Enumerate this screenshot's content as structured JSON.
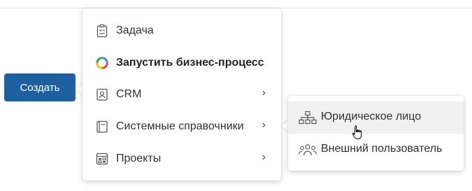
{
  "create_button": {
    "label": "Создать"
  },
  "main_menu": {
    "items": [
      {
        "label": "Задача",
        "icon": "task-clipboard-icon",
        "has_submenu": false
      },
      {
        "label": "Запустить бизнес-процесс",
        "icon": "business-process-ring-icon",
        "has_submenu": false,
        "bold": true
      },
      {
        "label": "CRM",
        "icon": "crm-contact-card-icon",
        "has_submenu": true,
        "arrow": "›"
      },
      {
        "label": "Системные справочники",
        "icon": "book-icon",
        "has_submenu": true,
        "arrow": "›"
      },
      {
        "label": "Проекты",
        "icon": "projects-board-icon",
        "has_submenu": true,
        "arrow": "›"
      }
    ]
  },
  "sub_menu": {
    "items": [
      {
        "label": "Юридическое лицо",
        "icon": "org-structure-icon",
        "hovered": true
      },
      {
        "label": "Внешний пользователь",
        "icon": "users-group-icon",
        "hovered": false
      }
    ]
  },
  "colors": {
    "button": "#1d5fa0",
    "hover": "#f0f0f0"
  }
}
